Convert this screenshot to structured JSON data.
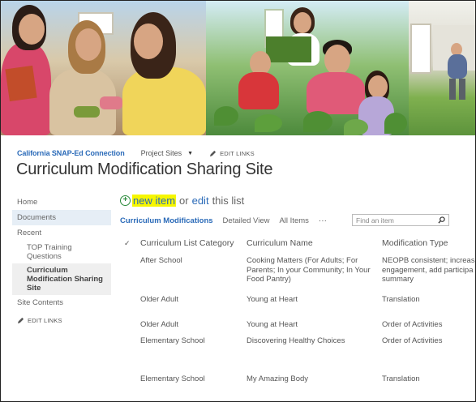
{
  "header": {
    "site_name": "California SNAP-Ed Connection",
    "project_sites": "Project Sites",
    "edit_links": "EDIT LINKS",
    "page_title": "Curriculum Modification Sharing Site"
  },
  "nav": {
    "home": "Home",
    "documents": "Documents",
    "recent": "Recent",
    "recent_items": [
      "TOP Training Questions",
      "Curriculum Modification Sharing Site"
    ],
    "site_contents": "Site Contents",
    "edit_links": "EDIT LINKS"
  },
  "actions": {
    "new_item": "new item",
    "or": "or",
    "edit": "edit",
    "this_list": "this list"
  },
  "views": {
    "tabs": [
      "Curriculum Modifications",
      "Detailed View",
      "All Items"
    ],
    "more": "···"
  },
  "search": {
    "placeholder": "Find an item"
  },
  "table": {
    "check_mark": "✓",
    "columns": [
      "Curriculum List Category",
      "Curriculum Name",
      "Modification Type"
    ],
    "rows": [
      {
        "category": "After School",
        "name": "Cooking Matters (For Adults; For\nParents; In your Community; In Your\nFood Pantry)",
        "mod": "NEOPB consistent; increase\nengagement, add participa\nsummary"
      },
      {
        "category": "Older Adult",
        "name": "Young at Heart",
        "mod": "Translation"
      },
      {
        "category": "Older Adult",
        "name": "Young at Heart",
        "mod": "Order of Activities"
      },
      {
        "category": "Elementary School",
        "name": "Discovering Healthy Choices",
        "mod": "Order of Activities"
      },
      {
        "category": "Elementary School",
        "name": "My Amazing Body",
        "mod": "Translation"
      }
    ]
  },
  "icons": {
    "plus": "plus-circle-icon",
    "pencil": "pencil-icon",
    "search": "search-icon",
    "caret": "caret-down-icon"
  },
  "colors": {
    "link": "#2a6ab8",
    "highlight": "#f6f600",
    "selected_nav": "#e6eef6",
    "plus_green": "#2a8a3a"
  }
}
